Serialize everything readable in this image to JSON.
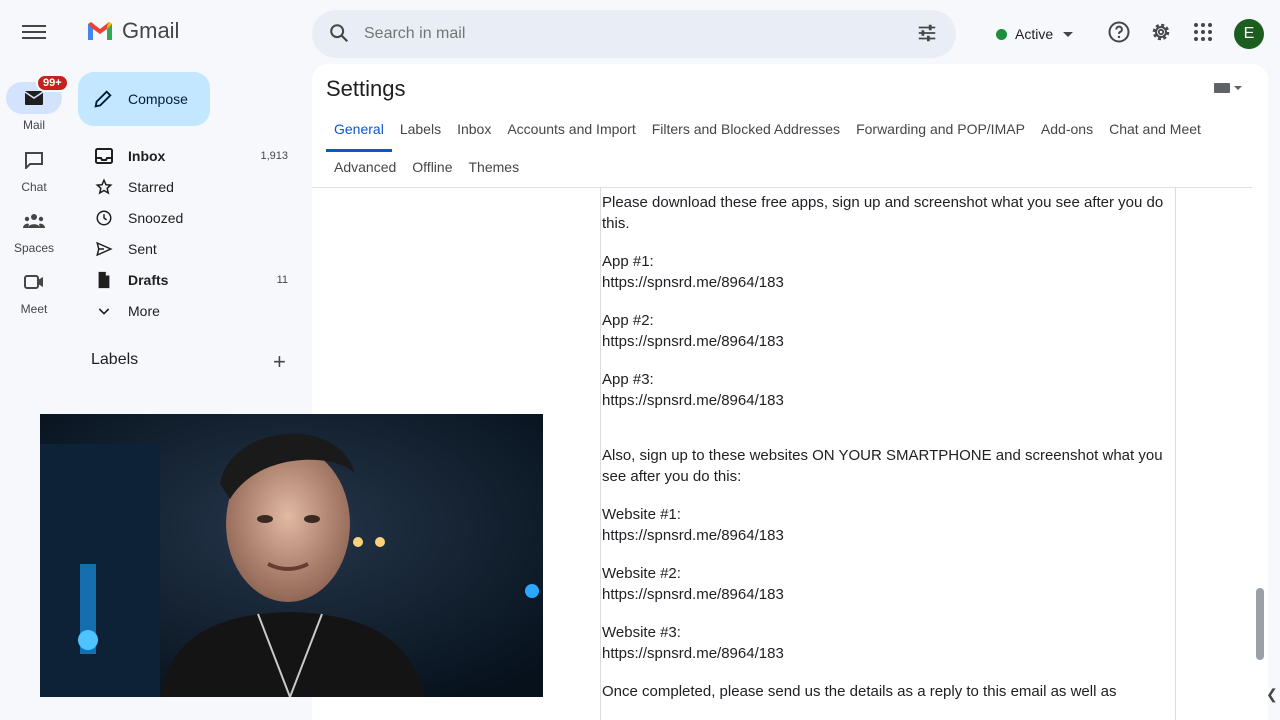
{
  "app": {
    "name": "Gmail"
  },
  "search": {
    "placeholder": "Search in mail"
  },
  "status": {
    "label": "Active",
    "color": "#1e8e3e"
  },
  "account": {
    "initial": "E",
    "color": "#1b5e20"
  },
  "rail": {
    "mail": {
      "label": "Mail",
      "badge": "99+"
    },
    "chat": {
      "label": "Chat"
    },
    "spaces": {
      "label": "Spaces"
    },
    "meet": {
      "label": "Meet"
    }
  },
  "compose": {
    "label": "Compose"
  },
  "nav": {
    "items": [
      {
        "label": "Inbox",
        "count": "1,913",
        "icon": "inbox-icon"
      },
      {
        "label": "Starred",
        "count": "",
        "icon": "star-icon"
      },
      {
        "label": "Snoozed",
        "count": "",
        "icon": "clock-icon"
      },
      {
        "label": "Sent",
        "count": "",
        "icon": "send-icon"
      },
      {
        "label": "Drafts",
        "count": "11",
        "icon": "draft-icon"
      },
      {
        "label": "More",
        "count": "",
        "icon": "chevron-down-icon"
      }
    ],
    "labels_heading": "Labels"
  },
  "settings": {
    "title": "Settings",
    "tabs_row1": [
      "General",
      "Labels",
      "Inbox",
      "Accounts and Import",
      "Filters and Blocked Addresses",
      "Forwarding and POP/IMAP",
      "Add-ons",
      "Chat and Meet"
    ],
    "tabs_row2": [
      "Advanced",
      "Offline",
      "Themes"
    ],
    "active_tab": "General"
  },
  "message": {
    "intro": "Please download these free apps, sign up and screenshot what you see after you do this.",
    "app1_label": "App #1:",
    "app1_url": "https://spnsrd.me/8964/183",
    "app2_label": "App #2:",
    "app2_url": "https://spnsrd.me/8964/183",
    "app3_label": "App #3:",
    "app3_url": "https://spnsrd.me/8964/183",
    "also": "Also, sign up to these websites ON YOUR SMARTPHONE and screenshot what you see after you do this:",
    "web1_label": "Website #1:",
    "web1_url": "https://spnsrd.me/8964/183",
    "web2_label": "Website #2:",
    "web2_url": "https://spnsrd.me/8964/183",
    "web3_label": "Website #3:",
    "web3_url": "https://spnsrd.me/8964/183",
    "outro": "Once completed, please send us the details as a reply to this email as well as"
  }
}
